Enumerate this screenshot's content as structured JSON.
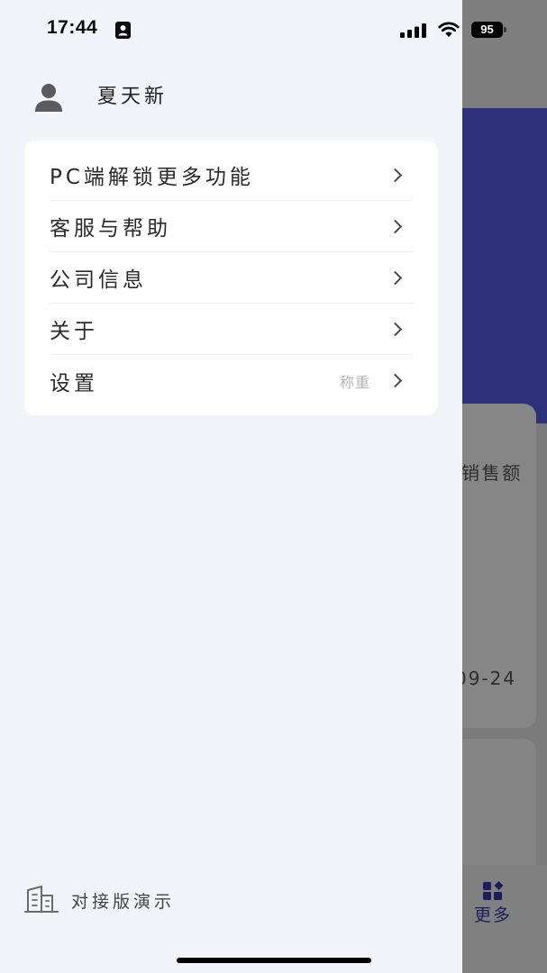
{
  "status_bar": {
    "time": "17:44",
    "battery": "95"
  },
  "drawer": {
    "user": {
      "name": "夏天新"
    },
    "menu": [
      {
        "label": "PC端解锁更多功能"
      },
      {
        "label": "客服与帮助"
      },
      {
        "label": "公司信息"
      },
      {
        "label": "关于"
      },
      {
        "label": "设置",
        "hint": "称重"
      }
    ],
    "footer": {
      "company": "对接版演示"
    }
  },
  "background": {
    "card_title": "销售额",
    "card_date": "09-24",
    "tab_more_label": "更多"
  },
  "icons": {
    "avatar": "person-icon",
    "menu_arrow": "chevron-right-icon",
    "footer": "building-icon",
    "tab_more": "grid-icon"
  },
  "colors": {
    "drawer_bg": "#f3f3fa",
    "card_bg": "#ffffff",
    "banner": "#2e3079",
    "tab_accent": "#1c1e5c"
  }
}
